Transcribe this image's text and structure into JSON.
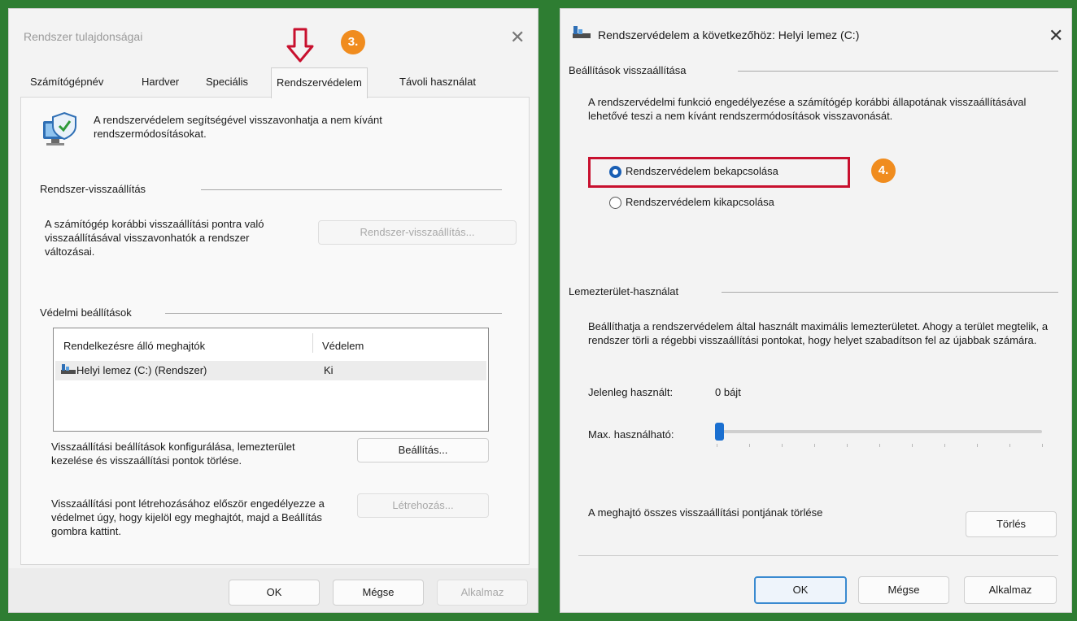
{
  "left_dialog": {
    "title": "Rendszer tulajdonságai",
    "close_glyph": "✕",
    "step_badge": "3.",
    "tabs": [
      "Számítógépnév",
      "Hardver",
      "Speciális",
      "Rendszervédelem",
      "Távoli használat"
    ],
    "intro_text": "A rendszervédelem segítségével visszavonhatja a nem kívánt rendszermódosításokat.",
    "restore_group": {
      "heading": "Rendszer-visszaállítás",
      "text": "A számítógép korábbi visszaállítási pontra való visszaállításával visszavonhatók a rendszer változásai.",
      "button": "Rendszer-visszaállítás..."
    },
    "protection_group": {
      "heading": "Védelmi beállítások",
      "columns": [
        "Rendelkezésre álló meghajtók",
        "Védelem"
      ],
      "rows": [
        {
          "drive": "Helyi lemez (C:) (Rendszer)",
          "protection": "Ki"
        }
      ],
      "configure_text": "Visszaállítási beállítások konfigurálása, lemezterület kezelése és visszaállítási pontok törlése.",
      "configure_button": "Beállítás...",
      "create_text": "Visszaállítási pont létrehozásához először engedélyezze a védelmet úgy, hogy kijelöl egy meghajtót, majd a Beállítás gombra kattint.",
      "create_button": "Létrehozás..."
    },
    "footer": {
      "ok": "OK",
      "cancel": "Mégse",
      "apply": "Alkalmaz"
    }
  },
  "right_dialog": {
    "title": "Rendszervédelem a következőhöz: Helyi lemez (C:)",
    "close_glyph": "✕",
    "step_badge": "4.",
    "restore_settings": {
      "heading": "Beállítások visszaállítása",
      "text": "A rendszervédelmi funkció engedélyezése a számítógép korábbi állapotának visszaállításával lehetővé teszi a nem kívánt rendszermódosítások visszavonását.",
      "option_on": "Rendszervédelem bekapcsolása",
      "option_off": "Rendszervédelem kikapcsolása",
      "selected": "on"
    },
    "disk_usage": {
      "heading": "Lemezterület-használat",
      "text": "Beállíthatja a rendszervédelem által használt maximális lemezterületet. Ahogy a terület megtelik, a rendszer törli a régebbi visszaállítási pontokat, hogy helyet szabadítson fel az újabbak számára.",
      "current_label": "Jelenleg használt:",
      "current_value": "0 bájt",
      "max_label": "Max. használható:",
      "max_fraction": 0.0
    },
    "delete_text": "A meghajtó összes visszaállítási pontjának törlése",
    "delete_button": "Törlés",
    "footer": {
      "ok": "OK",
      "cancel": "Mégse",
      "apply": "Alkalmaz"
    }
  },
  "colors": {
    "background": "#2e7d32",
    "badge": "#f08c1e",
    "highlight": "#c8102e",
    "accent": "#1a6fd0",
    "arrow": "#c8102e"
  }
}
